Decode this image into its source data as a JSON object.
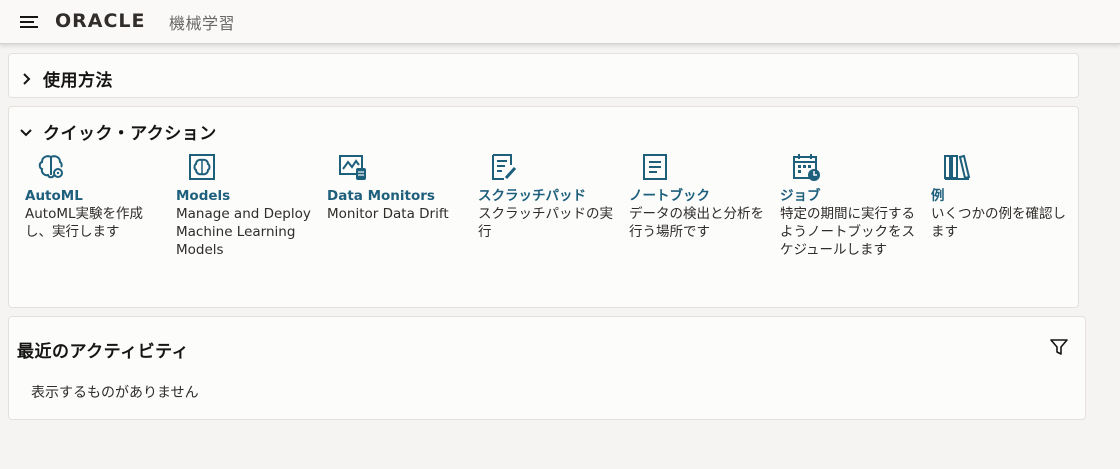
{
  "header": {
    "brand": "ORACLE",
    "product": "機械学習"
  },
  "usage": {
    "title": "使用方法"
  },
  "quick_actions": {
    "title": "クイック・アクション",
    "items": [
      {
        "icon": "automl-brain-icon",
        "name": "AutoML",
        "desc": "AutoML実験を作成し、実行します"
      },
      {
        "icon": "models-chip-icon",
        "name": "Models",
        "desc": "Manage and Deploy Machine Learning Models"
      },
      {
        "icon": "data-monitor-icon",
        "name": "Data Monitors",
        "desc": "Monitor Data Drift"
      },
      {
        "icon": "scratchpad-icon",
        "name": "スクラッチパッド",
        "desc": "スクラッチパッドの実行"
      },
      {
        "icon": "notebook-icon",
        "name": "ノートブック",
        "desc": "データの検出と分析を行う場所です"
      },
      {
        "icon": "job-calendar-icon",
        "name": "ジョブ",
        "desc": "特定の期間に実行するようノートブックをスケジュールします"
      },
      {
        "icon": "examples-library-icon",
        "name": "例",
        "desc": "いくつかの例を確認します"
      }
    ]
  },
  "recent": {
    "title": "最近のアクティビティ",
    "empty": "表示するものがありません"
  },
  "colors": {
    "accent": "#1e5f7c",
    "background": "#f5f4f2",
    "panel": "#fcfcfb"
  }
}
